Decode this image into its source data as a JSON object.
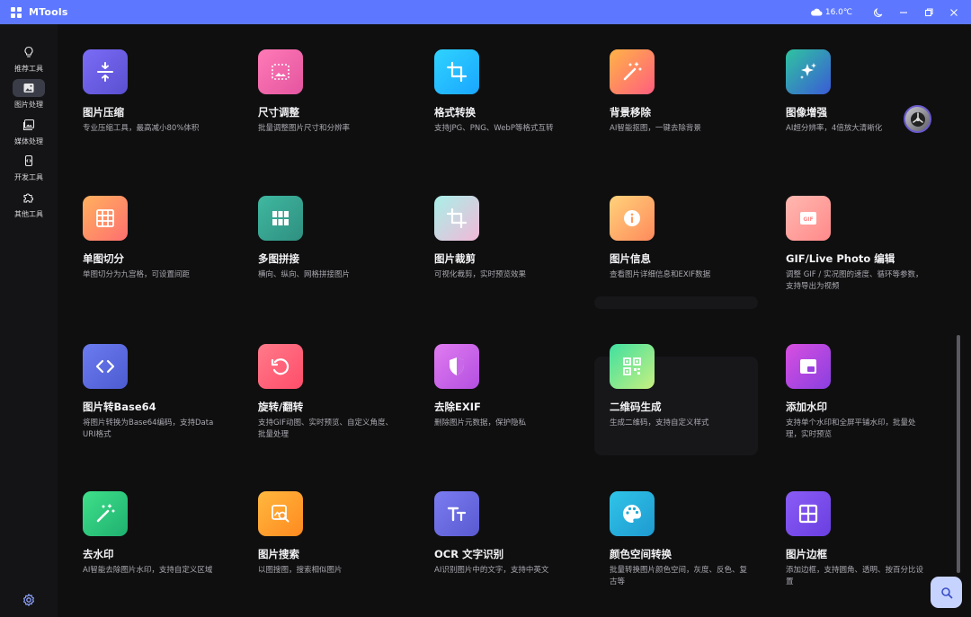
{
  "app": {
    "title": "MTools",
    "weather": "16.0℃"
  },
  "sidebar": {
    "items": [
      {
        "label": "推荐工具",
        "icon": "lightbulb-icon"
      },
      {
        "label": "图片处理",
        "icon": "image-icon"
      },
      {
        "label": "媒体处理",
        "icon": "media-icon"
      },
      {
        "label": "开发工具",
        "icon": "code-icon"
      },
      {
        "label": "其他工具",
        "icon": "puzzle-icon"
      }
    ],
    "settings_icon": "gear-icon"
  },
  "tools": [
    {
      "title": "图片压缩",
      "desc": "专业压缩工具，最高减小80%体积",
      "icon": "compress-icon",
      "grad": [
        "#7b6cf6",
        "#5a4fd0"
      ]
    },
    {
      "title": "尺寸调整",
      "desc": "批量调整图片尺寸和分辨率",
      "icon": "resize-icon",
      "grad": [
        "#ff7ab6",
        "#e455a0"
      ]
    },
    {
      "title": "格式转换",
      "desc": "支持JPG、PNG、WebP等格式互转",
      "icon": "crop-icon",
      "grad": [
        "#2fd3ff",
        "#1aa6ff"
      ]
    },
    {
      "title": "背景移除",
      "desc": "AI智能抠图，一键去除背景",
      "icon": "magic-wand-icon",
      "grad": [
        "#ffb347",
        "#ff5e7e"
      ]
    },
    {
      "title": "图像增强",
      "desc": "AI超分辨率，4倍放大清晰化",
      "icon": "sparkles-icon",
      "grad": [
        "#2fc4a0",
        "#3a5bd6"
      ]
    },
    {
      "title": "单图切分",
      "desc": "单图切分为九宫格，可设置间距",
      "icon": "grid-icon",
      "grad": [
        "#ffb15e",
        "#ff6f6f"
      ]
    },
    {
      "title": "多图拼接",
      "desc": "横向、纵向、网格拼接图片",
      "icon": "tiles-icon",
      "grad": [
        "#3fb8a0",
        "#2f8f80"
      ]
    },
    {
      "title": "图片裁剪",
      "desc": "可视化裁剪，实时预览效果",
      "icon": "crop-icon",
      "grad": [
        "#a8f0e8",
        "#f2b8d8"
      ]
    },
    {
      "title": "图片信息",
      "desc": "查看图片详细信息和EXIF数据",
      "icon": "info-icon",
      "grad": [
        "#ffd27a",
        "#ff8a5c"
      ]
    },
    {
      "title": "GIF/Live Photo 编辑",
      "desc": "调整 GIF / 实况图的速度、循环等参数，支持导出为视频",
      "icon": "gif-icon",
      "grad": [
        "#ffb8b0",
        "#ff8a8a"
      ]
    },
    {
      "title": "图片转Base64",
      "desc": "将图片转换为Base64编码，支持Data URI格式",
      "icon": "code-brackets-icon",
      "grad": [
        "#6b7cf0",
        "#4d5bd0"
      ]
    },
    {
      "title": "旋转/翻转",
      "desc": "支持GIF动图、实时预览、自定义角度、批量处理",
      "icon": "rotate-icon",
      "grad": [
        "#ff7a8a",
        "#ff4d6a"
      ]
    },
    {
      "title": "去除EXIF",
      "desc": "删除图片元数据，保护隐私",
      "icon": "shield-icon",
      "grad": [
        "#e07cf0",
        "#b34fe0"
      ]
    },
    {
      "title": "二维码生成",
      "desc": "生成二维码，支持自定义样式",
      "icon": "qrcode-icon",
      "grad": [
        "#3fe0a0",
        "#c8f080"
      ]
    },
    {
      "title": "添加水印",
      "desc": "支持单个水印和全屏平铺水印，批量处理，实时预览",
      "icon": "watermark-icon",
      "grad": [
        "#d84fe0",
        "#8a3fe0"
      ]
    },
    {
      "title": "去水印",
      "desc": "AI智能去除图片水印，支持自定义区域",
      "icon": "magic-wand-icon",
      "grad": [
        "#3fe08a",
        "#1fb070"
      ]
    },
    {
      "title": "图片搜索",
      "desc": "以图搜图，搜索相似图片",
      "icon": "image-search-icon",
      "grad": [
        "#ffb83f",
        "#ff8a1f"
      ]
    },
    {
      "title": "OCR 文字识别",
      "desc": "AI识别图片中的文字，支持中英文",
      "icon": "text-icon",
      "grad": [
        "#7a7cf0",
        "#5a5ad0"
      ]
    },
    {
      "title": "颜色空间转换",
      "desc": "批量转换图片颜色空间，灰度、反色、复古等",
      "icon": "palette-icon",
      "grad": [
        "#2fc4e8",
        "#1f9ad0"
      ]
    },
    {
      "title": "图片边框",
      "desc": "添加边框，支持圆角、透明、按百分比设置",
      "icon": "border-icon",
      "grad": [
        "#8a5cf6",
        "#6a3fe0"
      ]
    }
  ]
}
